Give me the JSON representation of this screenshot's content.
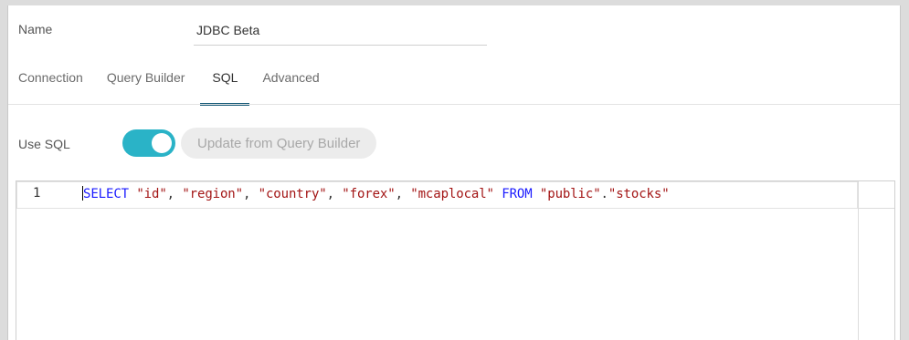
{
  "form": {
    "name_label": "Name",
    "name_value": "JDBC Beta"
  },
  "tabs": [
    {
      "label": "Connection",
      "active": false
    },
    {
      "label": "Query Builder",
      "active": false
    },
    {
      "label": "SQL",
      "active": true
    },
    {
      "label": "Advanced",
      "active": false
    }
  ],
  "sql": {
    "use_sql_label": "Use SQL",
    "use_sql_enabled": true,
    "update_button_label": "Update from Query Builder"
  },
  "editor": {
    "line_number": "1",
    "tokens": [
      {
        "type": "kw",
        "text": "SELECT"
      },
      {
        "type": "plain",
        "text": " "
      },
      {
        "type": "str",
        "text": "\"id\""
      },
      {
        "type": "plain",
        "text": ", "
      },
      {
        "type": "str",
        "text": "\"region\""
      },
      {
        "type": "plain",
        "text": ", "
      },
      {
        "type": "str",
        "text": "\"country\""
      },
      {
        "type": "plain",
        "text": ", "
      },
      {
        "type": "str",
        "text": "\"forex\""
      },
      {
        "type": "plain",
        "text": ", "
      },
      {
        "type": "str",
        "text": "\"mcaplocal\""
      },
      {
        "type": "plain",
        "text": " "
      },
      {
        "type": "kw",
        "text": "FROM"
      },
      {
        "type": "plain",
        "text": " "
      },
      {
        "type": "str",
        "text": "\"public\""
      },
      {
        "type": "plain",
        "text": "."
      },
      {
        "type": "str",
        "text": "\"stocks\""
      }
    ]
  },
  "colors": {
    "accent": "#2ab3c7",
    "tab_underline": "#1a5d7a",
    "keyword": "#1a1aff",
    "string": "#a31515"
  }
}
